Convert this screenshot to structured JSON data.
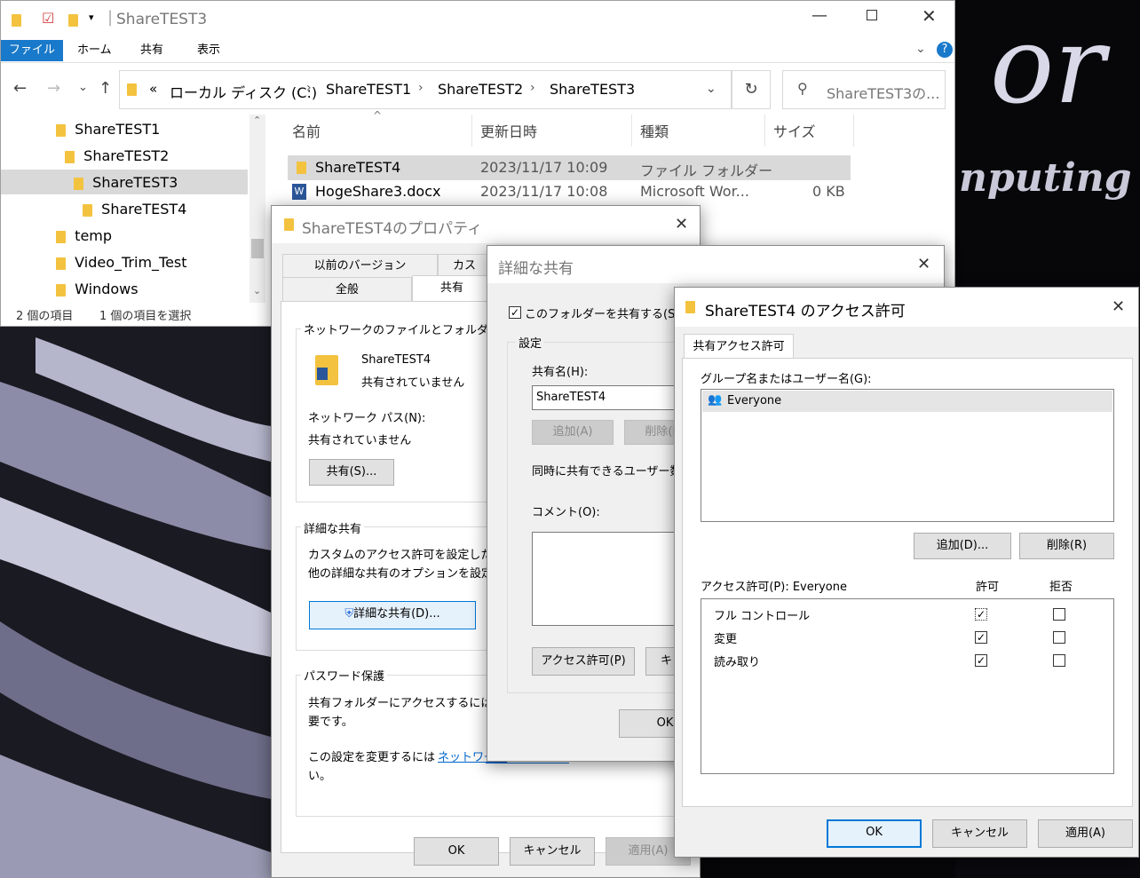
{
  "explorer": {
    "title": "ShareTEST3",
    "ribbon_tabs": [
      "ファイル",
      "ホーム",
      "共有",
      "表示"
    ],
    "breadcrumb": [
      "«",
      "ローカル ディスク (C:)",
      "ShareTEST1",
      "ShareTEST2",
      "ShareTEST3"
    ],
    "search_placeholder": "ShareTEST3の...",
    "tree": [
      "ShareTEST1",
      "ShareTEST2",
      "ShareTEST3",
      "ShareTEST4",
      "temp",
      "Video_Trim_Test",
      "Windows"
    ],
    "columns": [
      "名前",
      "更新日時",
      "種類",
      "サイズ"
    ],
    "rows": [
      {
        "name": "ShareTEST4",
        "date": "2023/11/17 10:09",
        "type": "ファイル フォルダー",
        "size": ""
      },
      {
        "name": "HogeShare3.docx",
        "date": "2023/11/17 10:08",
        "type": "Microsoft Wor...",
        "size": "0 KB"
      }
    ],
    "status_items": "2 個の項目",
    "status_selected": "1 個の項目を選択"
  },
  "props": {
    "title": "ShareTEST4のプロパティ",
    "tabs_row1": [
      "以前のバージョン",
      "カス"
    ],
    "tabs_row2": [
      "全般",
      "共有"
    ],
    "group_network_title": "ネットワークのファイルとフォルダーの共",
    "folder_name": "ShareTEST4",
    "folder_status": "共有されていません",
    "network_path_label": "ネットワーク パス(N):",
    "network_path_value": "共有されていません",
    "share_button": "共有(S)...",
    "advanced_group_title": "詳細な共有",
    "advanced_text1": "カスタムのアクセス許可を設定したり",
    "advanced_text2": "他の詳細な共有のオプションを設定",
    "advanced_button": "詳細な共有(D)...",
    "password_group_title": "パスワード保護",
    "password_text1": "共有フォルダーにアクセスするには、",
    "password_text2": "要です。",
    "password_text3": "この設定を変更するには",
    "password_link": "ネットワーク",
    "password_text4": "い。",
    "ok": "OK",
    "cancel": "キャンセル",
    "apply": "適用(A)"
  },
  "advanced": {
    "title": "詳細な共有",
    "share_checkbox": "このフォルダーを共有する(S)",
    "settings_title": "設定",
    "share_name_label": "共有名(H):",
    "share_name_value": "ShareTEST4",
    "add": "追加(A)",
    "remove": "削除(R)",
    "limit_label": "同時に共有できるユーザー数",
    "comment_label": "コメント(O):",
    "permissions_button": "アクセス許可(P)",
    "cache_button": "キャ",
    "ok": "OK"
  },
  "perm": {
    "title": "ShareTEST4 のアクセス許可",
    "tab": "共有アクセス許可",
    "group_label": "グループ名またはユーザー名(G):",
    "users": [
      "Everyone"
    ],
    "add": "追加(D)...",
    "remove": "削除(R)",
    "perm_label": "アクセス許可(P): Everyone",
    "allow_header": "許可",
    "deny_header": "拒否",
    "rows": [
      {
        "name": "フル コントロール",
        "allow": true,
        "deny": false
      },
      {
        "name": "変更",
        "allow": true,
        "deny": false
      },
      {
        "name": "読み取り",
        "allow": true,
        "deny": false
      }
    ],
    "ok": "OK",
    "cancel": "キャンセル",
    "apply": "適用(A)"
  },
  "wallpaper": {
    "text1": "or",
    "text2": "nputing"
  },
  "colors": {
    "accent": "#0078d7",
    "selection": "#cce8ff",
    "selected_row": "#d9d9d9",
    "link": "#0066cc",
    "folder": "#f3c23f"
  }
}
